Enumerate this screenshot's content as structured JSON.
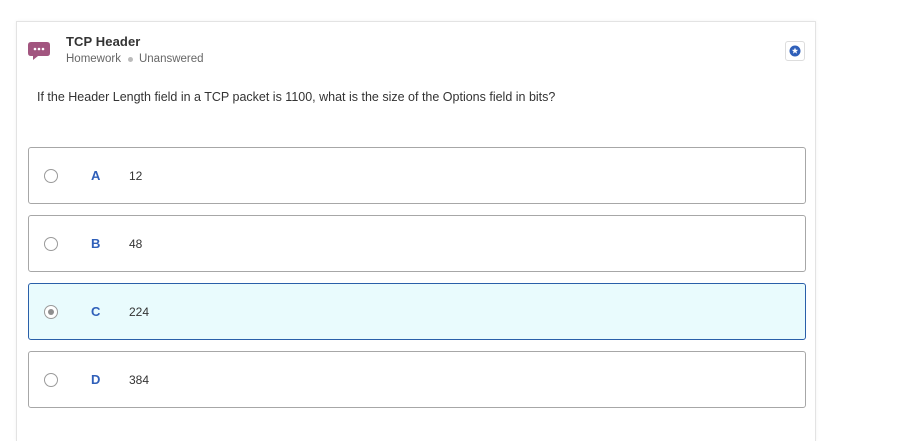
{
  "header": {
    "title": "TCP Header",
    "category": "Homework",
    "status": "Unanswered",
    "avatar_icon": "chat-bubble-ellipsis-icon",
    "avatar_color": "#a2557f",
    "bookmark_icon": "star-badge-icon",
    "bookmark_color": "#2f5fb9"
  },
  "question": {
    "text": "If the Header Length field in a TCP packet is 1100, what is the size of the Options field in bits?"
  },
  "options": [
    {
      "letter": "A",
      "value": "12",
      "selected": false
    },
    {
      "letter": "B",
      "value": "48",
      "selected": false
    },
    {
      "letter": "C",
      "value": "224",
      "selected": true
    },
    {
      "letter": "D",
      "value": "384",
      "selected": false
    }
  ],
  "colors": {
    "accent": "#2f5fb9",
    "selected_bg": "#e9fbfd",
    "selected_border": "#2a5fa9"
  }
}
